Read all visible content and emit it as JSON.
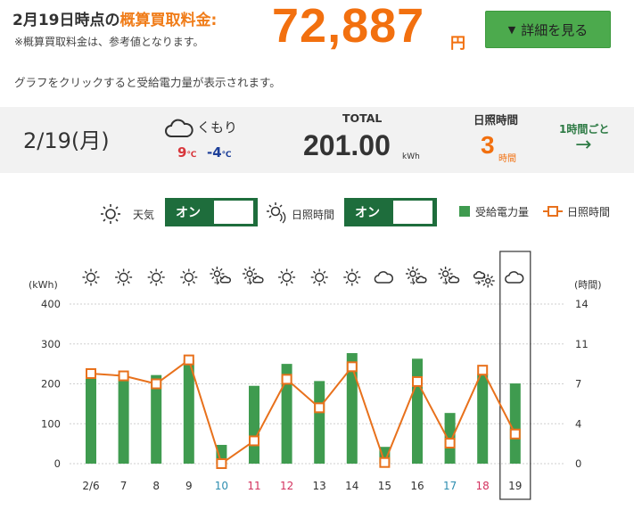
{
  "header": {
    "title_prefix": "2月19日時点の",
    "title_highlight": "概算買取料金:",
    "amount": "72,887",
    "amount_unit": "円",
    "note": "※概算買取料金は、参考値となります。",
    "detail_button": "詳細を見る",
    "detail_button_icon": "triangle-down-icon",
    "hint": "グラフをクリックすると受給電力量が表示されます。"
  },
  "day": {
    "date": "2/19(月)",
    "weather": "くもり",
    "weather_icon": "cloud-icon",
    "temp_max": "9",
    "temp_min": "-4",
    "temp_unit": "℃",
    "total_label": "TOTAL",
    "total_value": "201.00",
    "total_unit": "kWh",
    "sunshine_label": "日照時間",
    "sunshine_value": "3",
    "sunshine_unit": "時間",
    "hourly_link": "1時間ごと",
    "hourly_arrow": "→"
  },
  "controls": {
    "weather_toggle_label": "天気",
    "weather_toggle_state": "オン",
    "sunshine_toggle_label": "日照時間",
    "sunshine_toggle_state": "オン",
    "legend_power": "受給電力量",
    "legend_sunshine": "日照時間"
  },
  "colors": {
    "bar": "#3f9b4f",
    "line": "#e8711c",
    "accent": "#f2700f",
    "sat": "#2e8eb0",
    "sun": "#d3325f",
    "toggle": "#1e6d3c"
  },
  "chart_data": {
    "type": "bar",
    "left_unit": "(kWh)",
    "right_unit": "(時間)",
    "categories": [
      "2/6",
      "7",
      "8",
      "9",
      "10",
      "11",
      "12",
      "13",
      "14",
      "15",
      "16",
      "17",
      "18",
      "19"
    ],
    "category_colors": [
      "#333",
      "#333",
      "#333",
      "#333",
      "#2e8eb0",
      "#d3325f",
      "#d3325f",
      "#333",
      "#333",
      "#333",
      "#333",
      "#2e8eb0",
      "#d3325f",
      "#333"
    ],
    "weather_icons": [
      "sun-icon",
      "sun-icon",
      "sun-icon",
      "sun-icon",
      "sun-to-rain-icon",
      "sun-to-rain-icon",
      "sun-icon",
      "sun-icon",
      "sun-icon",
      "cloud-icon",
      "sun-to-cloud-icon",
      "sun-to-rain-icon",
      "rain-to-sun-icon",
      "cloud-icon"
    ],
    "y_left_ticks": [
      "0",
      "100",
      "200",
      "300",
      "400"
    ],
    "y_left_range": [
      0,
      400
    ],
    "y_right_ticks": [
      "0",
      "4",
      "7",
      "11",
      "14"
    ],
    "y_right_range": [
      0,
      14
    ],
    "series": [
      {
        "name": "受給電力量",
        "type": "bar",
        "axis": "left",
        "values": [
          225,
          225,
          222,
          260,
          47,
          195,
          250,
          207,
          277,
          42,
          263,
          127,
          225,
          201
        ]
      },
      {
        "name": "日照時間",
        "type": "line",
        "axis": "right",
        "values": [
          7.9,
          7.7,
          7.0,
          9.1,
          0.0,
          2.0,
          7.4,
          4.9,
          8.5,
          0.1,
          7.2,
          1.8,
          8.2,
          2.6
        ]
      }
    ],
    "selected_index": 13
  }
}
